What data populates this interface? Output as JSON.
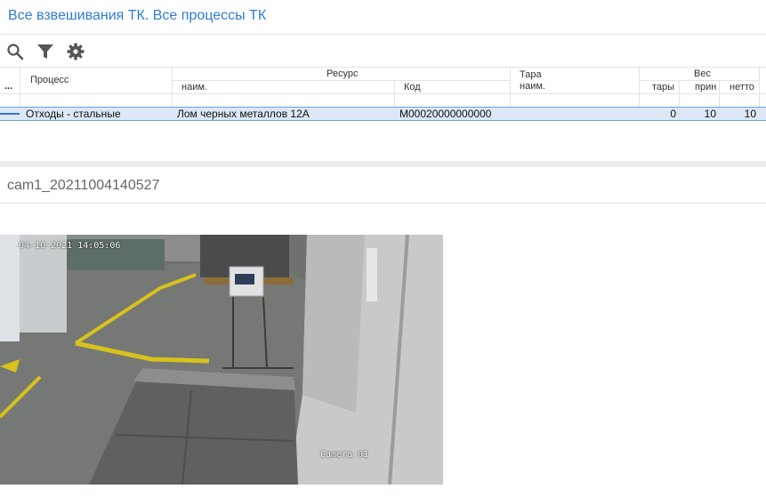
{
  "page": {
    "title": "Все взвешивания ТК. Все процессы ТК"
  },
  "toolbar": {
    "search": "search-icon",
    "filter": "filter-icon",
    "settings": "gear-icon"
  },
  "grid": {
    "menu": "...",
    "headers": {
      "process": "Процесс",
      "resource": "Ресурс",
      "resource_name": "наим.",
      "resource_code": "Код",
      "tare": "Тара",
      "tare_name": "наим.",
      "weight": "Вес",
      "weight_tare": "тары",
      "weight_accepted": "прин",
      "weight_net": "нетто"
    },
    "rows": [
      {
        "process": "Отходы - стальные",
        "resource_name": "Лом черных металлов 12А",
        "resource_code": "М00020000000000",
        "tare_name": "",
        "weight_tare": "0",
        "weight_accepted": "10",
        "weight_net": "10"
      }
    ]
  },
  "image": {
    "title": "cam1_20211004140527",
    "timestamp": "04-10-2021 14:05:06",
    "camera_label": "Camera 01"
  },
  "colors": {
    "accent": "#2f7bd3",
    "selection": "#dce8f8"
  }
}
